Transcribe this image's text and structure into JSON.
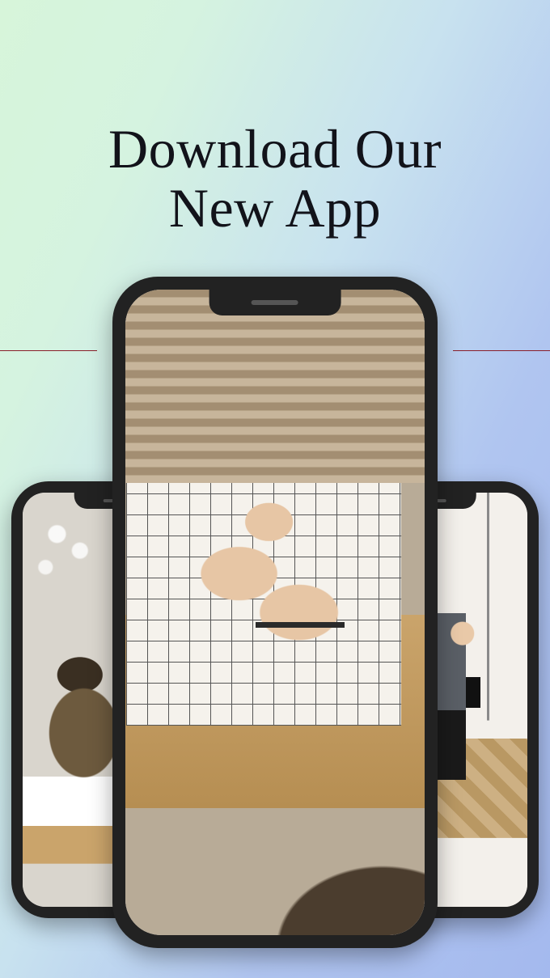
{
  "headline": {
    "line1": "Download Our",
    "line2": "New App"
  }
}
